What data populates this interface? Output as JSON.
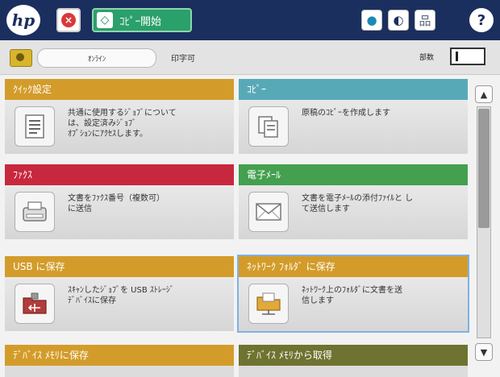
{
  "topbar": {
    "logo": "hp",
    "stop_icon": "×",
    "start_icon": "◇",
    "start_label": "ｺﾋﾟｰ開始",
    "globe_icon": "●",
    "moon_icon": "◐",
    "network_icon": "品",
    "help_icon": "?"
  },
  "status": {
    "pill_label": "ｵﾝﾗｲﾝ",
    "status_text": "印字可",
    "copies_label": "部数"
  },
  "tiles": [
    {
      "title": "ｸｲｯｸ設定",
      "desc": "共通に使用するｼﾞｮﾌﾞについて\nは、設定済みｼﾞｮﾌﾞ\nｵﾌﾟｼｮﾝにｱｸｾｽします。",
      "icon": "document-list-icon"
    },
    {
      "title": "ｺﾋﾟｰ",
      "desc": "原稿のｺﾋﾟｰを作成します",
      "icon": "copy-pages-icon"
    },
    {
      "title": "ﾌｧｸｽ",
      "desc": "文書をﾌｧｸｽ番号（複数可）\nに送信",
      "icon": "fax-icon"
    },
    {
      "title": "電子ﾒｰﾙ",
      "desc": "文書を電子ﾒｰﾙの添付ﾌｧｲﾙと し\nて送信します",
      "icon": "envelope-icon"
    },
    {
      "title": "USB に保存",
      "desc": "ｽｷｬﾝしたｼﾞｮﾌﾞを USB ｽﾄﾚｰｼﾞ\nﾃﾞﾊﾞｲｽに保存",
      "icon": "usb-folder-icon"
    },
    {
      "title": "ﾈｯﾄﾜｰｸ ﾌｫﾙﾀﾞ に保存",
      "desc": "ﾈｯﾄﾜｰｸ上のﾌｫﾙﾀﾞに文書を送\n信します",
      "icon": "network-folder-icon"
    },
    {
      "title": "ﾃﾞﾊﾞｲｽ ﾒﾓﾘに保存",
      "desc": "",
      "icon": "device-memory-icon"
    },
    {
      "title": "ﾃﾞﾊﾞｲｽ ﾒﾓﾘから取得",
      "desc": "",
      "icon": "device-retrieve-icon"
    }
  ],
  "scroll": {
    "up_icon": "▲",
    "down_icon": "▼"
  },
  "colors": {
    "topbar": "#1b2f5e",
    "orange": "#d39c2a",
    "red": "#c8283e",
    "teal": "#58a9b8",
    "green": "#43a04e",
    "olive": "#6f7330",
    "selected_outline": "#7fb1e0"
  }
}
